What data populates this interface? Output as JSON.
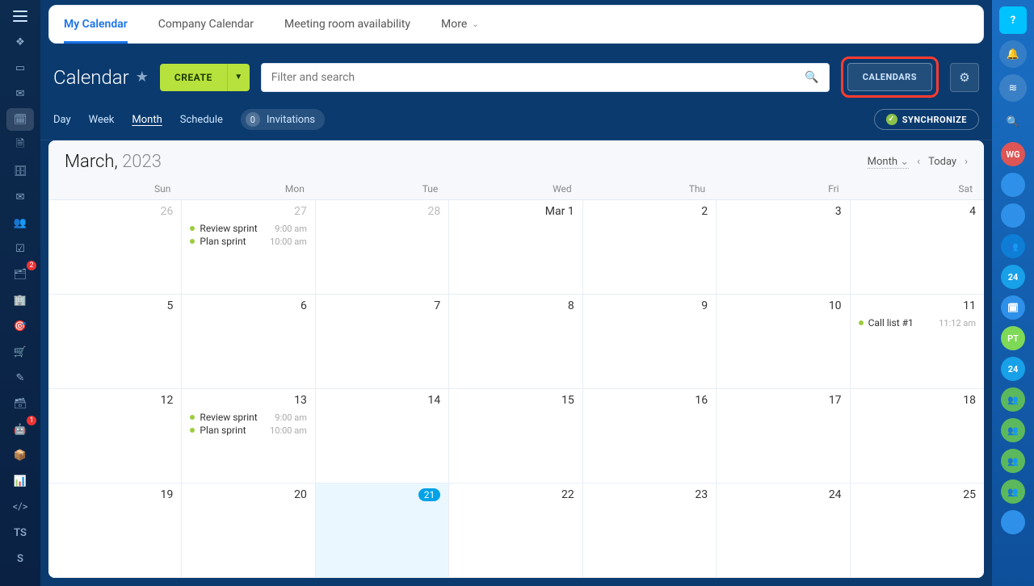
{
  "left_rail": {
    "items": [
      {
        "name": "menu-icon",
        "glyph": "≡"
      },
      {
        "name": "feed-icon",
        "glyph": "❖"
      },
      {
        "name": "file-icon",
        "glyph": "▭"
      },
      {
        "name": "chat-icon",
        "glyph": "✉"
      },
      {
        "name": "calendar-icon",
        "glyph": "🗓",
        "active": true
      },
      {
        "name": "docs-icon",
        "glyph": "🗎"
      },
      {
        "name": "drive-icon",
        "glyph": "🗄"
      },
      {
        "name": "mail-icon",
        "glyph": "✉"
      },
      {
        "name": "workgroups-icon",
        "glyph": "👥"
      },
      {
        "name": "tasks-icon",
        "glyph": "☑"
      },
      {
        "name": "filter-icon",
        "glyph": "🗂",
        "badge": "2"
      },
      {
        "name": "company-icon",
        "glyph": "🏢"
      },
      {
        "name": "target-icon",
        "glyph": "🎯"
      },
      {
        "name": "cart-icon",
        "glyph": "🛒"
      },
      {
        "name": "sign-icon",
        "glyph": "✎"
      },
      {
        "name": "card-icon",
        "glyph": "🗃"
      },
      {
        "name": "robot-icon",
        "glyph": "🤖",
        "badge": "1"
      },
      {
        "name": "box-icon",
        "glyph": "📦"
      },
      {
        "name": "market-icon",
        "glyph": "📊"
      },
      {
        "name": "code-icon",
        "glyph": "</>"
      }
    ],
    "text_items": [
      "TS",
      "S"
    ]
  },
  "tabs": [
    {
      "label": "My Calendar",
      "active": true
    },
    {
      "label": "Company Calendar"
    },
    {
      "label": "Meeting room availability"
    },
    {
      "label": "More",
      "caret": true
    }
  ],
  "title": "Calendar",
  "create_label": "CREATE",
  "search_placeholder": "Filter and search",
  "calendars_label": "CALENDARS",
  "views": [
    {
      "label": "Day"
    },
    {
      "label": "Week"
    },
    {
      "label": "Month",
      "active": true
    },
    {
      "label": "Schedule"
    }
  ],
  "invitations": {
    "count": "0",
    "label": "Invitations"
  },
  "synchronize_label": "SYNCHRONIZE",
  "calendar": {
    "month_label": "March,",
    "year_label": "2023",
    "scale_label": "Month",
    "today_label": "Today",
    "dow": [
      "Sun",
      "Mon",
      "Tue",
      "Wed",
      "Thu",
      "Fri",
      "Sat"
    ],
    "weeks": [
      [
        {
          "n": "26",
          "out": true
        },
        {
          "n": "27",
          "out": true,
          "events": [
            {
              "title": "Review sprint",
              "time": "9:00 am"
            },
            {
              "title": "Plan sprint",
              "time": "10:00 am"
            }
          ]
        },
        {
          "n": "28",
          "out": true
        },
        {
          "n": "Mar 1"
        },
        {
          "n": "2"
        },
        {
          "n": "3"
        },
        {
          "n": "4"
        }
      ],
      [
        {
          "n": "5"
        },
        {
          "n": "6"
        },
        {
          "n": "7"
        },
        {
          "n": "8"
        },
        {
          "n": "9"
        },
        {
          "n": "10"
        },
        {
          "n": "11",
          "events": [
            {
              "title": "Call list #1",
              "time": "11:12 am"
            }
          ]
        }
      ],
      [
        {
          "n": "12"
        },
        {
          "n": "13",
          "events": [
            {
              "title": "Review sprint",
              "time": "9:00 am"
            },
            {
              "title": "Plan sprint",
              "time": "10:00 am"
            }
          ]
        },
        {
          "n": "14"
        },
        {
          "n": "15"
        },
        {
          "n": "16"
        },
        {
          "n": "17"
        },
        {
          "n": "18"
        }
      ],
      [
        {
          "n": "19"
        },
        {
          "n": "20"
        },
        {
          "n": "21",
          "selected": true,
          "pill": true
        },
        {
          "n": "22"
        },
        {
          "n": "23"
        },
        {
          "n": "24"
        },
        {
          "n": "25"
        }
      ]
    ]
  },
  "right_rail": {
    "items": [
      {
        "name": "help-button",
        "cls": "help sq",
        "text": "?"
      },
      {
        "name": "notifications-button",
        "cls": "bell",
        "text": "🔔"
      },
      {
        "name": "activity-button",
        "cls": "circle",
        "text": "≋"
      },
      {
        "name": "search-button",
        "cls": "mag",
        "text": "🔍"
      },
      {
        "name": "avatar-wg",
        "cls": "",
        "avatar": "wg",
        "text": "WG"
      },
      {
        "name": "avatar-1",
        "cls": "",
        "avatar": "blu",
        "text": ""
      },
      {
        "name": "avatar-2",
        "cls": "",
        "avatar": "blu",
        "text": ""
      },
      {
        "name": "avatar-group",
        "cls": "",
        "avatar": "grp",
        "text": "👥"
      },
      {
        "name": "avatar-24a",
        "cls": "",
        "avatar": "n24",
        "text": "24"
      },
      {
        "name": "avatar-cal",
        "cls": "",
        "avatar": "blu",
        "text": "🗓"
      },
      {
        "name": "avatar-pt",
        "cls": "",
        "avatar": "pt",
        "text": "PT"
      },
      {
        "name": "avatar-24b",
        "cls": "",
        "avatar": "n24",
        "text": "24"
      },
      {
        "name": "avatar-grp2",
        "cls": "",
        "avatar": "grn",
        "text": "👥"
      },
      {
        "name": "avatar-grp3",
        "cls": "",
        "avatar": "grn",
        "text": "👥"
      },
      {
        "name": "avatar-grp4",
        "cls": "",
        "avatar": "grn",
        "text": "👥"
      },
      {
        "name": "avatar-grp5",
        "cls": "",
        "avatar": "grn",
        "text": "👥"
      },
      {
        "name": "avatar-user",
        "cls": "",
        "avatar": "blu",
        "text": ""
      }
    ]
  }
}
